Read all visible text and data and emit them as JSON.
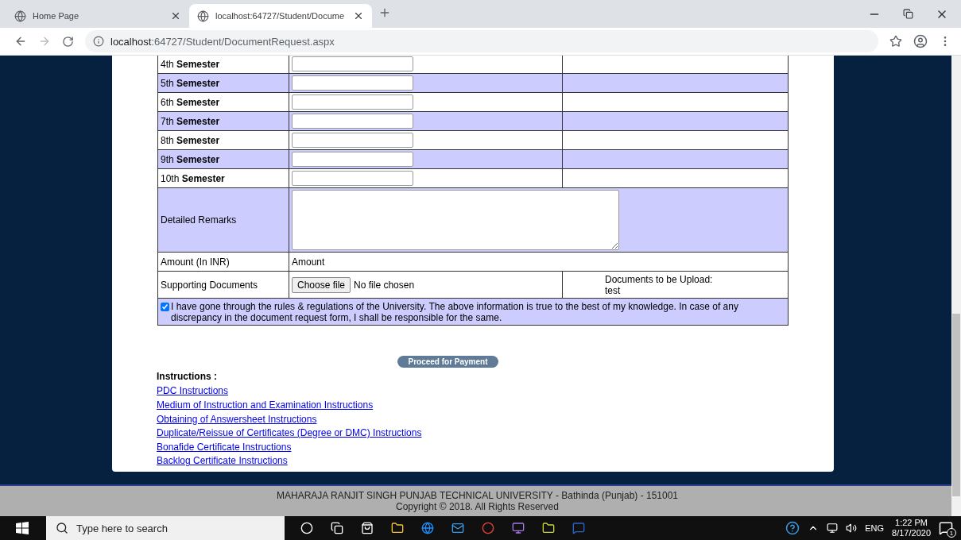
{
  "browser": {
    "tabs": [
      {
        "title": "Home Page",
        "selected": false
      },
      {
        "title": "localhost:64727/Student/Docume",
        "selected": true
      }
    ],
    "address": {
      "host": "localhost",
      "rest": ":64727/Student/DocumentRequest.aspx"
    }
  },
  "form": {
    "semesters": [
      {
        "label": "4th **Semester**"
      },
      {
        "label": "5th **Semester**"
      },
      {
        "label": "6th **Semester**"
      },
      {
        "label": "7th **Semester**"
      },
      {
        "label": "8th **Semester**"
      },
      {
        "label": "9th **Semester**"
      },
      {
        "label": "10th **Semester**"
      }
    ],
    "remarks_label": "Detailed Remarks",
    "amount_label": "Amount (In INR)",
    "amount_value": "Amount",
    "documents_label": "Supporting Documents",
    "file_button": "Choose file",
    "file_status": "No file chosen",
    "documents_note": "Documents to be Upload:",
    "documents_value": "test",
    "declaration": {
      "checked": true,
      "text": "I have gone through the rules & regulations of the University. The above information is true to the best of my knowledge. In case of any discrepancy in the document request form, I shall be responsible for the same."
    },
    "submit": "Proceed for Payment"
  },
  "instructions": {
    "heading": "Instructions :",
    "links": [
      "PDC Instructions",
      "Medium of Instruction and Examination Instructions",
      "Obtaining of Answersheet Instructions",
      "Duplicate/Reissue of Certificates (Degree or DMC) Instructions",
      "Bonafide Certificate Instructions",
      "Backlog Certificate Instructions"
    ]
  },
  "footer": {
    "line1": "MAHARAJA RANJIT SINGH PUNJAB TECHNICAL UNIVERSITY - Bathinda (Punjab) - 151001",
    "line2": "Copyright © 2018. All Rights Reserved"
  },
  "taskbar": {
    "search_placeholder": "Type here to search",
    "language": "ENG",
    "time": "1:22 PM",
    "date": "8/17/2020",
    "notification_count": "1"
  }
}
